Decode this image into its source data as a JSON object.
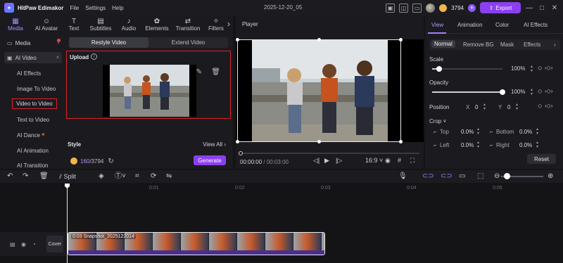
{
  "app": {
    "name": "HitPaw Edimakor",
    "menu": [
      "File",
      "Settings",
      "Help"
    ],
    "doc_title": "2025-12-20_05",
    "credits": "3794",
    "export_label": "Export"
  },
  "tools": [
    {
      "label": "Media",
      "icon": "media-icon",
      "active": true
    },
    {
      "label": "AI Avatar",
      "icon": "avatar-icon",
      "active": false
    },
    {
      "label": "Text",
      "icon": "text-icon",
      "active": false
    },
    {
      "label": "Subtitles",
      "icon": "subtitles-icon",
      "active": false
    },
    {
      "label": "Audio",
      "icon": "audio-icon",
      "active": false
    },
    {
      "label": "Elements",
      "icon": "elements-icon",
      "active": false
    },
    {
      "label": "Transition",
      "icon": "transition-icon",
      "active": false
    },
    {
      "label": "Filters",
      "icon": "filters-icon",
      "active": false
    }
  ],
  "sidebar": {
    "media": "Media",
    "ai_video": "AI Video",
    "items": [
      "AI Effects",
      "Image To Video",
      "Video to Video",
      "Text to Video",
      "AI Dance",
      "AI Animation",
      "AI Transition"
    ]
  },
  "content": {
    "tabs": [
      "Restyle Video",
      "Extend Video"
    ],
    "upload_title": "Upload",
    "style_label": "Style",
    "view_all": "View All",
    "credits_used": "160",
    "credits_total": "/3794",
    "generate": "Generate"
  },
  "player": {
    "title": "Player",
    "current_time": "00:00:00",
    "total_time": "/ 00:03:00",
    "aspect": "16:9"
  },
  "inspector": {
    "tabs": [
      "View",
      "Animation",
      "Color",
      "AI Effects"
    ],
    "sub_tabs": [
      "Normal",
      "Remove BG",
      "Mask",
      "Effects"
    ],
    "scale_label": "Scale",
    "scale_value": "100%",
    "scale_level": 0.1,
    "opacity_label": "Opacity",
    "opacity_value": "100%",
    "opacity_level": 1.0,
    "position_label": "Position",
    "pos_x_label": "X",
    "pos_x": "0",
    "pos_y_label": "Y",
    "pos_y": "0",
    "crop_label": "Crop",
    "crop": [
      {
        "label": "Top",
        "value": "0.0%"
      },
      {
        "label": "Bottom",
        "value": "0.0%"
      },
      {
        "label": "Left",
        "value": "0.0%"
      },
      {
        "label": "Right",
        "value": "0.0%"
      }
    ],
    "reset": "Reset"
  },
  "timeline": {
    "split": "Split",
    "ticks": [
      "0:01",
      "0:02",
      "0:03",
      "0:04",
      "0:05"
    ],
    "cover": "Cover",
    "clip_label": "0:03 Snapshot_2025122014"
  },
  "colors": {
    "accent": "#8b3ff1",
    "highlight_border": "#e0202a",
    "panel": "#1b1b1f"
  }
}
